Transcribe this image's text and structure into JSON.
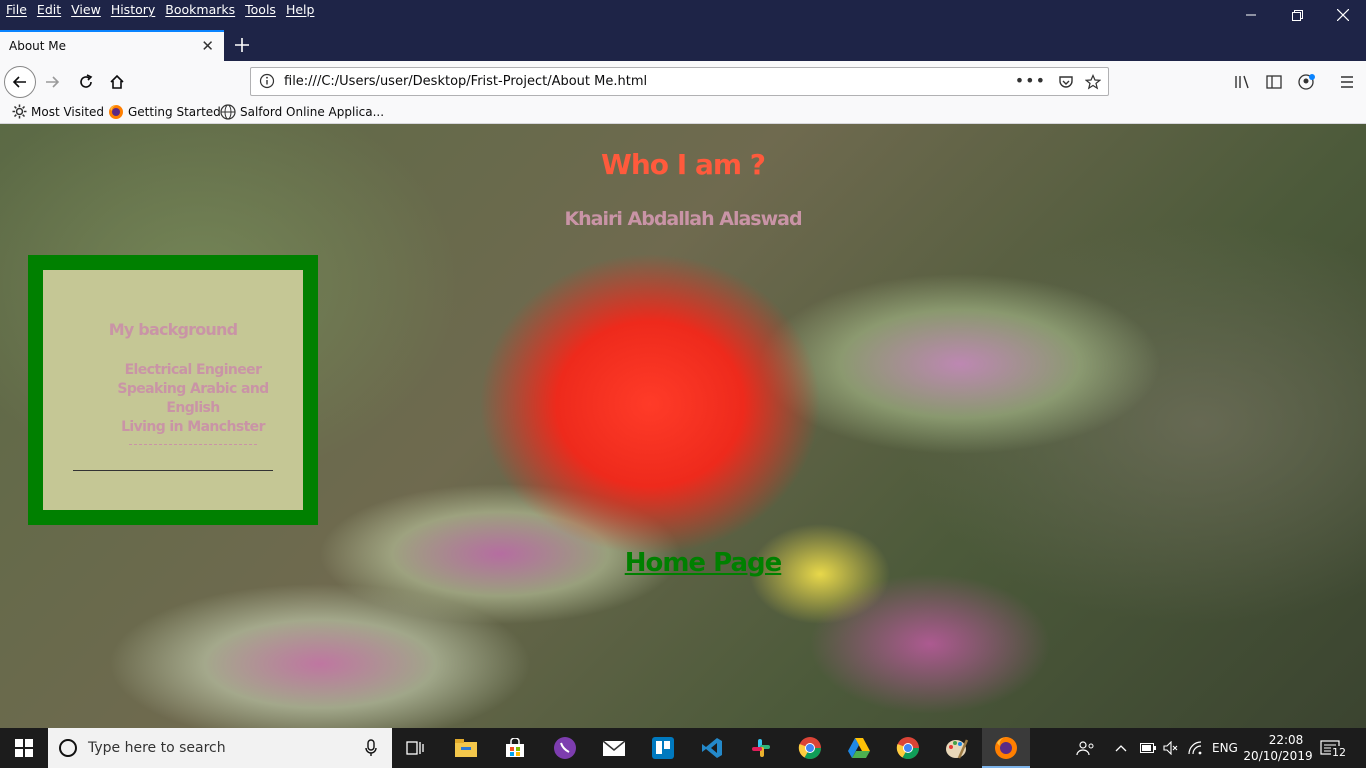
{
  "menubar": {
    "items": [
      "File",
      "Edit",
      "View",
      "History",
      "Bookmarks",
      "Tools",
      "Help"
    ]
  },
  "tab": {
    "title": "About Me"
  },
  "address": {
    "url": "file:///C:/Users/user/Desktop/Frist-Project/About Me.html"
  },
  "bookmarks": [
    {
      "label": "Most Visited",
      "icon": "gear-icon"
    },
    {
      "label": "Getting Started",
      "icon": "firefox-icon"
    },
    {
      "label": "Salford Online Applica...",
      "icon": "globe-icon"
    }
  ],
  "page": {
    "heading": "Who I am ?",
    "name": "Khairi Abdallah Alaswad",
    "card": {
      "title": "My background",
      "lines": [
        "Electrical Engineer",
        "Speaking Arabic and",
        "English",
        "Living in Manchster"
      ]
    },
    "home_link": "Home Page"
  },
  "taskbar": {
    "search_placeholder": "Type here to search",
    "language": "ENG",
    "time": "22:08",
    "date": "20/10/2019",
    "notifications": "12"
  },
  "colors": {
    "heading": "#ff5a3c",
    "pink_text": "#c994a6",
    "green": "#008000",
    "card_bg": "#c5c795",
    "chrome_dark": "#1e2447"
  }
}
